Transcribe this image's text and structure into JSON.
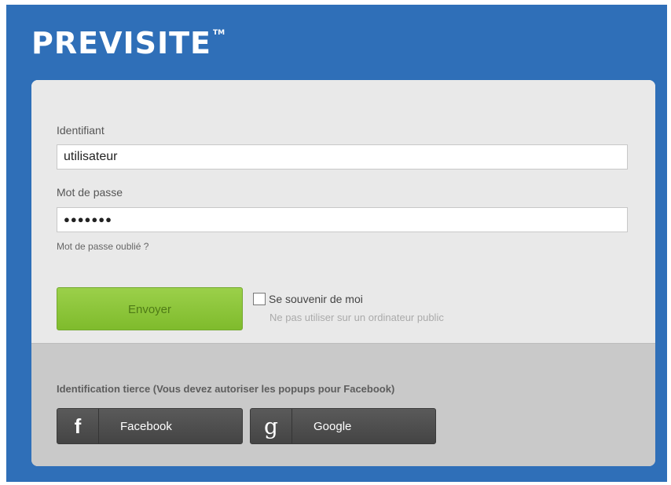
{
  "brand": {
    "logo_text_a": "PRE",
    "logo_text_b": "VISITE",
    "logo_tm": "TM"
  },
  "login": {
    "username_label": "Identifiant",
    "username_value": "utilisateur",
    "password_label": "Mot de passe",
    "password_value": "●●●●●●●",
    "forgot_link": "Mot de passe oublié ?",
    "submit_label": "Envoyer",
    "remember_label": "Se souvenir de moi",
    "remember_checked": false,
    "remember_hint": "Ne pas utiliser sur un ordinateur public"
  },
  "third_party": {
    "title": "Identification tierce (Vous devez autoriser les popups pour Facebook)",
    "buttons": [
      {
        "icon": "facebook-icon",
        "glyph": "f",
        "label": "Facebook"
      },
      {
        "icon": "google-icon",
        "glyph": "g",
        "label": "Google"
      }
    ]
  },
  "colors": {
    "background": "#2f6fb8",
    "submit_green": "#8cc63f",
    "social_dark": "#4a4a4a"
  }
}
